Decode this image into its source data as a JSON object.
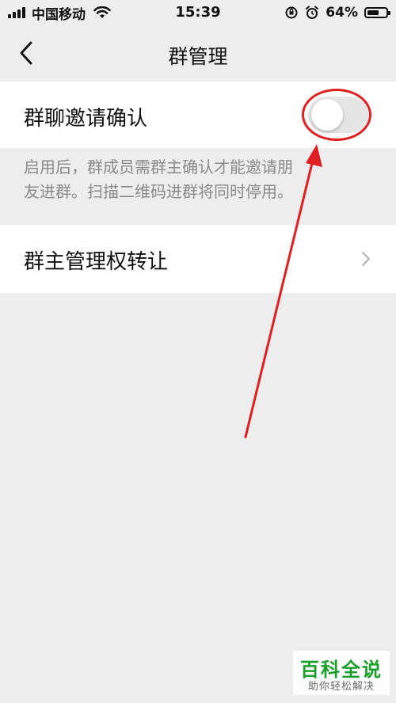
{
  "status_bar": {
    "carrier": "中国移动",
    "time": "15:39",
    "battery_percent": "64%",
    "battery_level": 0.64
  },
  "nav": {
    "title": "群管理",
    "back_icon": "chevron-left-icon"
  },
  "settings": {
    "invite_confirm_label": "群聊邀请确认",
    "invite_confirm_enabled": false,
    "invite_description_lines": [
      "启用后，群成员需群主确认才能邀请朋",
      "友进群。扫描二维码进群将同时停用。"
    ],
    "transfer_label": "群主管理权转让",
    "transfer_icon": "chevron-right-icon"
  },
  "annotation": {
    "color": "#e02020"
  },
  "watermark": {
    "title": "百科全说",
    "subtitle": "助你轻松解决",
    "color": "#1aa02a"
  }
}
